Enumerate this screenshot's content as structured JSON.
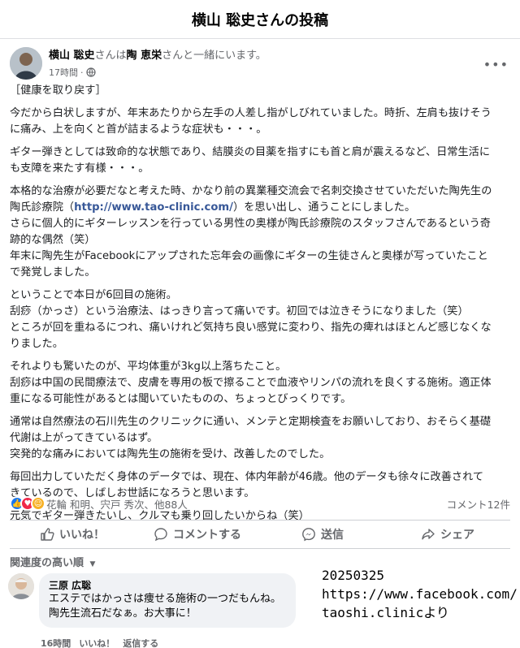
{
  "page_title": "横山 聡史さんの投稿",
  "post": {
    "author": "横山 聡史",
    "with_text_1": "さんは",
    "tagged": "陶 恵栄",
    "with_text_2": "さんと一緒にいます。",
    "time": "17時間",
    "more_label": "•••",
    "body": [
      [
        "［健康を取り戻す］"
      ],
      [
        "今だから白状しますが、年末あたりから左手の人差し指がしびれていました。時折、左肩も抜けそう",
        "に痛み、上を向くと首が詰まるような症状も・・・。"
      ],
      [
        "ギター弾きとしては致命的な状態であり、結膜炎の目薬を指すにも首と肩が震えるなど、日常生活に",
        "も支障を来たす有様・・・。"
      ],
      [
        "本格的な治療が必要だなと考えた時、かなり前の異業種交流会で名刺交換させていただいた陶先生の"
      ],
      [
        "さらに個人的にギターレッスンを行っている男性の奥様が陶氏診療院のスタッフさんであるという奇",
        "跡的な偶然（笑）",
        "年末に陶先生がFacebookにアップされた忘年会の画像にギターの生徒さんと奥様が写っていたこと",
        "で発覚しました。"
      ],
      [
        "ということで本日が6回目の施術。",
        "刮痧（かっさ）という治療法、はっきり言って痛いです。初回では泣きそうになりました（笑）",
        "ところが回を重ねるにつれ、痛いけれど気持ち良い感覚に変わり、指先の痺れはほとんど感じなくな",
        "りました。"
      ],
      [
        "それよりも驚いたのが、平均体重が3kg以上落ちたこと。",
        "刮痧は中国の民間療法で、皮膚を専用の板で擦ることで血液やリンパの流れを良くする施術。適正体",
        "重になる可能性があるとは聞いていたものの、ちょっとびっくりです。"
      ],
      [
        "通常は自然療法の石川先生のクリニックに通い、メンテと定期検査をお願いしており、おそらく基礎",
        "代謝は上がってきているはず。",
        "突発的な痛みにおいては陶先生の施術を受け、改善したのでした。"
      ],
      [
        "毎回出力していただく身体のデータでは、現在、体内年齢が46歳。他のデータも徐々に改善されて",
        "きているので、しばしお世話になろうと思います。"
      ],
      [
        "元気でギター弾きたいし、クルマも乗り回したいからね（笑）"
      ]
    ],
    "clinic_pre": "陶氏診療院（",
    "clinic_link": "http://www.tao-clinic.com/",
    "clinic_post": "）を思い出し、通うことにしました。",
    "reactions_text": "花輪 和明、宍戸 秀次、他88人",
    "comment_count": "コメント12件"
  },
  "actions": {
    "like": "いいね！",
    "comment": "コメントする",
    "send": "送信",
    "share": "シェア"
  },
  "sort_label": "関連度の高い順",
  "comment": {
    "name": "三原 広聡",
    "lines": [
      "エステではかっさは痩せる施術の一つだもんね。",
      "陶先生流石だなぁ。お大事に！"
    ],
    "time": "16時間",
    "like": "いいね！",
    "reply": "返信する"
  },
  "overlay": {
    "lines": [
      "20250325",
      "https://www.facebook.com/",
      "taoshi.clinicより"
    ]
  }
}
